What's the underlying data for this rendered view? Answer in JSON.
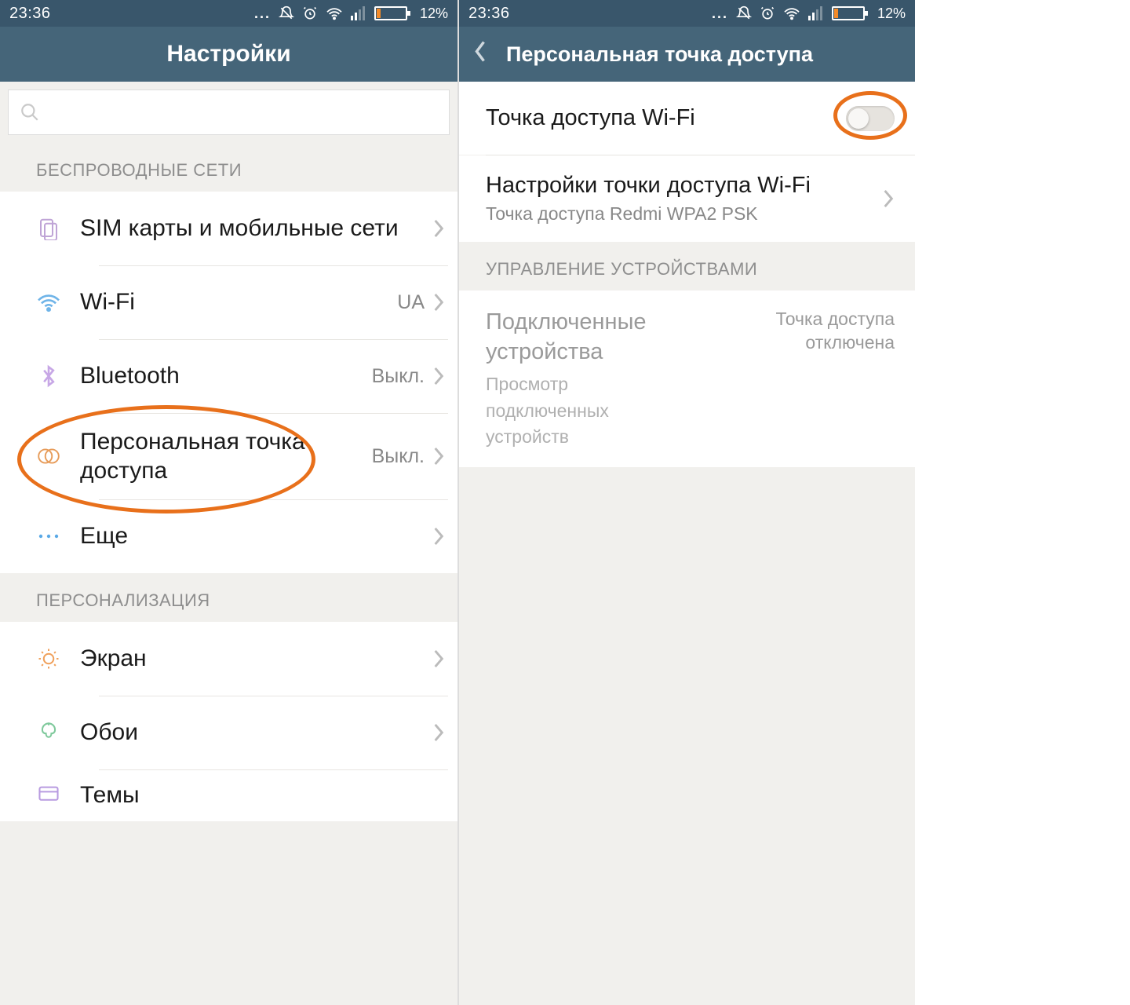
{
  "status": {
    "time": "23:36",
    "battery_pct": "12%"
  },
  "left": {
    "header_title": "Настройки",
    "section_wireless": "БЕСПРОВОДНЫЕ СЕТИ",
    "section_personalization": "ПЕРСОНАЛИЗАЦИЯ",
    "rows": {
      "sim": {
        "label": "SIM карты и мобильные сети"
      },
      "wifi": {
        "label": "Wi-Fi",
        "value": "UA"
      },
      "bluetooth": {
        "label": "Bluetooth",
        "value": "Выкл."
      },
      "hotspot": {
        "label": "Персональная точка доступа",
        "value": "Выкл."
      },
      "more": {
        "label": "Еще"
      },
      "screen": {
        "label": "Экран"
      },
      "wallpaper": {
        "label": "Обои"
      },
      "themes": {
        "label": "Темы"
      }
    }
  },
  "right": {
    "header_title": "Персональная точка доступа",
    "rows": {
      "hotspot_toggle": {
        "label": "Точка доступа Wi-Fi"
      },
      "hotspot_settings": {
        "label": "Настройки точки доступа Wi-Fi",
        "sub": "Точка доступа Redmi WPA2 PSK"
      }
    },
    "section_devices": "УПРАВЛЕНИЕ УСТРОЙСТВАМИ",
    "connected": {
      "label": "Подключенные устройства",
      "sub": "Просмотр подключенных устройств",
      "side": "Точка доступа отключена"
    }
  }
}
